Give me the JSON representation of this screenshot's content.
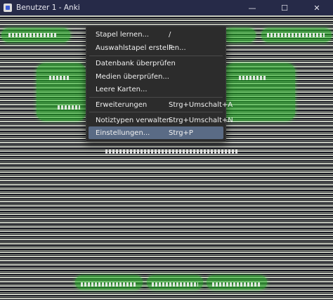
{
  "window": {
    "title": "Benutzer 1 - Anki",
    "minimize_icon": "minimize-icon",
    "maximize_icon": "maximize-icon",
    "close_icon": "close-icon"
  },
  "menu": {
    "items": [
      {
        "label": "Stapel lernen...",
        "shortcut": "/"
      },
      {
        "label": "Auswahlstapel erstellen...",
        "shortcut": "F"
      },
      {
        "label": "Datenbank überprüfen",
        "shortcut": ""
      },
      {
        "label": "Medien überprüfen...",
        "shortcut": ""
      },
      {
        "label": "Leere Karten...",
        "shortcut": ""
      },
      {
        "label": "Erweiterungen",
        "shortcut": "Strg+Umschalt+A"
      },
      {
        "label": "Notiztypen verwalten",
        "shortcut": "Strg+Umschalt+N"
      },
      {
        "label": "Einstellungen...",
        "shortcut": "Strg+P"
      }
    ],
    "active_index": 7
  },
  "colors": {
    "titlebar": "#262a48",
    "menu_bg": "#2c2c2c",
    "menu_active": "#5a6b85",
    "glow_green": "#28be28"
  }
}
